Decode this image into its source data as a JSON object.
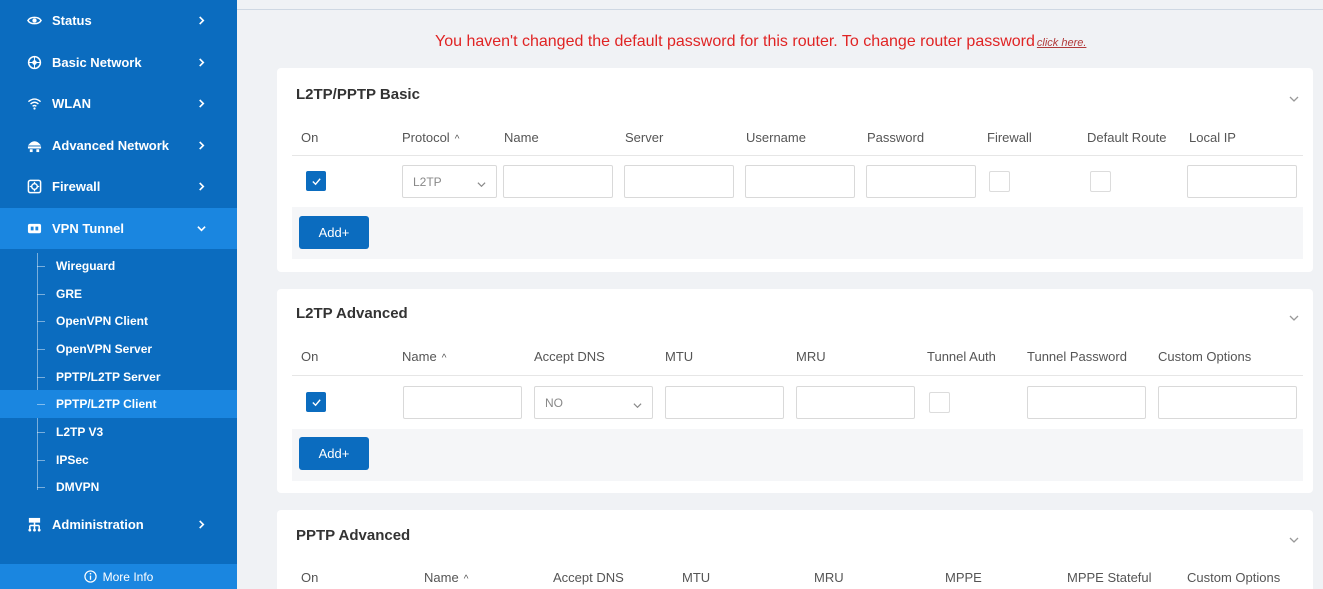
{
  "sidebar": {
    "items": [
      {
        "label": "Status",
        "icon": "eye-icon"
      },
      {
        "label": "Basic Network",
        "icon": "globe-icon"
      },
      {
        "label": "WLAN",
        "icon": "wifi-icon"
      },
      {
        "label": "Advanced Network",
        "icon": "network-icon"
      },
      {
        "label": "Firewall",
        "icon": "firewall-icon"
      },
      {
        "label": "VPN Tunnel",
        "icon": "vpn-icon"
      }
    ],
    "vpn_sub_items": [
      "Wireguard",
      "GRE",
      "OpenVPN Client",
      "OpenVPN Server",
      "PPTP/L2TP Server",
      "PPTP/L2TP Client",
      "L2TP V3",
      "IPSec",
      "DMVPN"
    ],
    "administration": {
      "label": "Administration",
      "icon": "admin-icon"
    },
    "more_info": "More Info"
  },
  "warning": {
    "text": "You haven't changed the default password for this router. To change router password",
    "link": "click here."
  },
  "l2tp_pptp_basic": {
    "title": "L2TP/PPTP Basic",
    "columns": [
      "On",
      "Protocol",
      "Name",
      "Server",
      "Username",
      "Password",
      "Firewall",
      "Default Route",
      "Local IP"
    ],
    "row": {
      "on": true,
      "protocol": "L2TP",
      "firewall": false,
      "default_route": false
    },
    "add_label": "Add+"
  },
  "l2tp_advanced": {
    "title": "L2TP Advanced",
    "columns": [
      "On",
      "Name",
      "Accept DNS",
      "MTU",
      "MRU",
      "Tunnel Auth",
      "Tunnel Password",
      "Custom Options"
    ],
    "row": {
      "on": true,
      "accept_dns": "NO",
      "tunnel_auth": false
    },
    "add_label": "Add+"
  },
  "pptp_advanced": {
    "title": "PPTP Advanced",
    "columns": [
      "On",
      "Name",
      "Accept DNS",
      "MTU",
      "MRU",
      "MPPE",
      "MPPE Stateful",
      "Custom Options"
    ]
  },
  "colors": {
    "brand": "#0b6cbf",
    "sidebar_active": "#1a86e0",
    "warning": "#e02424"
  }
}
